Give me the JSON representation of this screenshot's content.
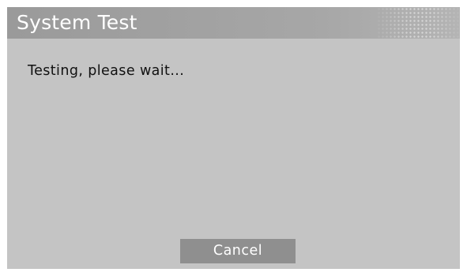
{
  "dialog": {
    "title": "System Test",
    "message": "Testing, please wait...",
    "cancel_label": "Cancel"
  },
  "colors": {
    "background": "#c4c4c4",
    "title_bar": "#a0a0a0",
    "title_text": "#ffffff",
    "message_text": "#111111",
    "button": "#8f8f8f",
    "button_text": "#ffffff"
  }
}
